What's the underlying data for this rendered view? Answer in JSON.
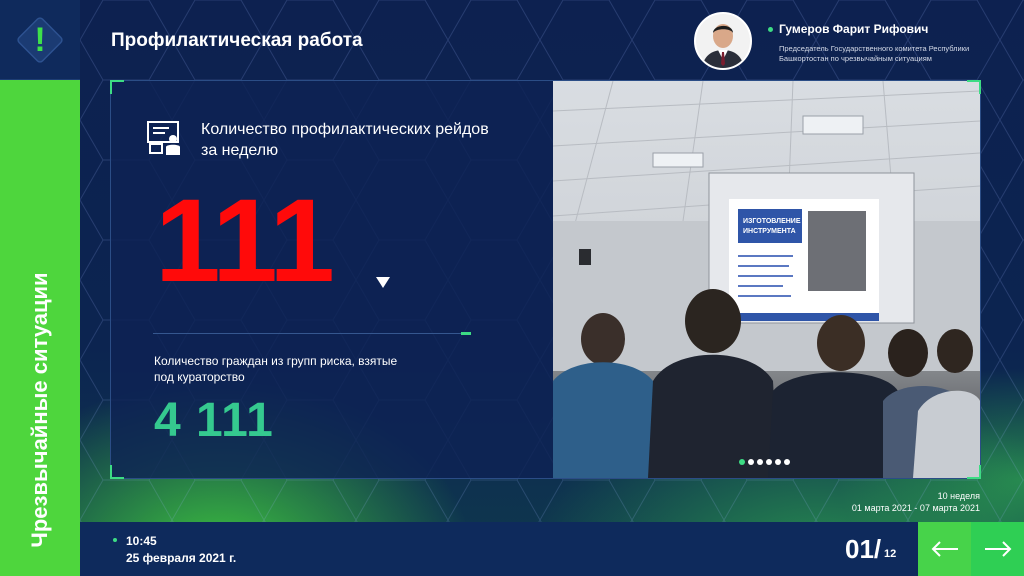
{
  "header": {
    "title": "Профилактическая работа",
    "person_name": "Гумеров Фарит Рифович",
    "person_role": "Председатель Государственного комитета Республики Башкортостан по чрезвычайным ситуациям"
  },
  "sidebar": {
    "label": "Чрезвычайные ситуации",
    "icon": "warning-icon",
    "accent": "#4ed63d"
  },
  "stats": {
    "raids_label": "Количество профилактических рейдов за неделю",
    "raids_value": "111",
    "raids_color": "#ff0a0a",
    "risk_label": "Количество граждан из групп риска, взятые под кураторство",
    "risk_value": "4 111",
    "risk_color": "#35c98f"
  },
  "photo": {
    "screen_heading": "ИЗГОТОВЛЕНИЕ ИНСТРУМЕНТА",
    "slide_count": 6,
    "active_slide": 1
  },
  "week": {
    "number": "10 неделя",
    "range": "01 марта 2021 - 07 марта 2021"
  },
  "footer": {
    "time": "10:45",
    "date": "25 февраля 2021 г.",
    "page_current": "01/",
    "page_total": "12"
  }
}
